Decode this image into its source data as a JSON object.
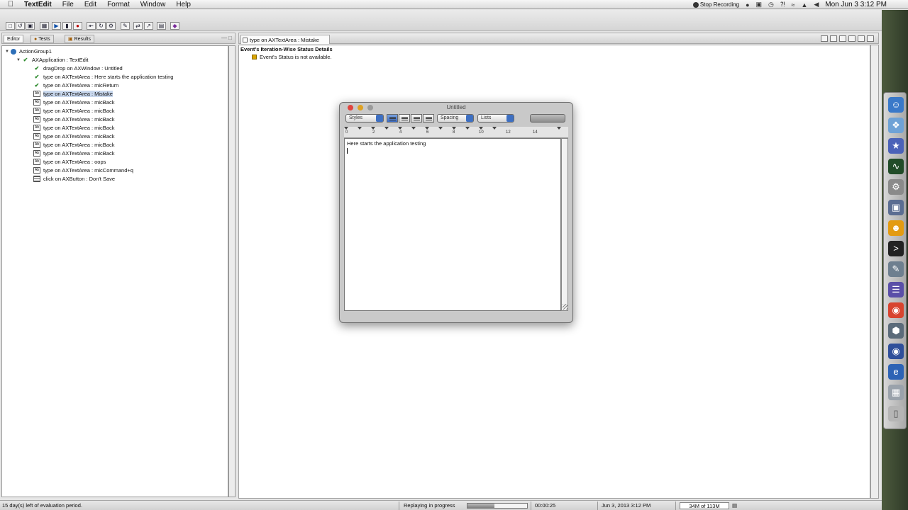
{
  "menubar": {
    "app": "TextEdit",
    "items": [
      "File",
      "Edit",
      "Format",
      "Window",
      "Help"
    ],
    "stop_recording": "Stop Recording",
    "clock": "Mon Jun 3  3:12 PM"
  },
  "left_panel": {
    "tabs": [
      "Editor",
      "Tests",
      "Results"
    ],
    "tree": [
      {
        "label": "ActionGroup1",
        "level": 0,
        "icon": "group-icon"
      },
      {
        "label": "AXApplication : TextEdit",
        "level": 1,
        "icon": "check-icon"
      },
      {
        "label": "dragDrop on AXWindow : Untitled",
        "level": 2,
        "icon": "check-icon"
      },
      {
        "label": "type on AXTextArea : Here starts the application testing",
        "level": 2,
        "icon": "check-icon"
      },
      {
        "label": "type on AXTextArea : micReturn",
        "level": 2,
        "icon": "check-icon"
      },
      {
        "label": "type on AXTextArea : Mistake",
        "level": 2,
        "icon": "type-icon",
        "selected": true
      },
      {
        "label": "type on AXTextArea : micBack",
        "level": 2,
        "icon": "type-icon"
      },
      {
        "label": "type on AXTextArea : micBack",
        "level": 2,
        "icon": "type-icon"
      },
      {
        "label": "type on AXTextArea : micBack",
        "level": 2,
        "icon": "type-icon"
      },
      {
        "label": "type on AXTextArea : micBack",
        "level": 2,
        "icon": "type-icon"
      },
      {
        "label": "type on AXTextArea : micBack",
        "level": 2,
        "icon": "type-icon"
      },
      {
        "label": "type on AXTextArea : micBack",
        "level": 2,
        "icon": "type-icon"
      },
      {
        "label": "type on AXTextArea : micBack",
        "level": 2,
        "icon": "type-icon"
      },
      {
        "label": "type on AXTextArea : oops",
        "level": 2,
        "icon": "type-icon"
      },
      {
        "label": "type on AXTextArea : micCommand+q",
        "level": 2,
        "icon": "type-icon"
      },
      {
        "label": "click on AXButton : Don't Save",
        "level": 2,
        "icon": "click-icon"
      }
    ]
  },
  "right_panel": {
    "tab": "type on AXTextArea : Mistake",
    "header": "Event's Iteration-Wise Status Details",
    "status": "Event's Status is not available."
  },
  "textedit": {
    "title": "Untitled",
    "styles": "Styles",
    "spacing": "Spacing",
    "lists": "Lists",
    "ruler": [
      "0",
      "2",
      "4",
      "6",
      "8",
      "10",
      "12",
      "14"
    ],
    "content": "Here starts the application testing"
  },
  "statusbar": {
    "evaluation": "15 day(s) left of evaluation period.",
    "replay": "Replaying in progress",
    "elapsed": "00:00:25",
    "datetime": "Jun 3, 2013 3:12 PM",
    "memory": "34M of 113M",
    "progress": 0.45
  }
}
